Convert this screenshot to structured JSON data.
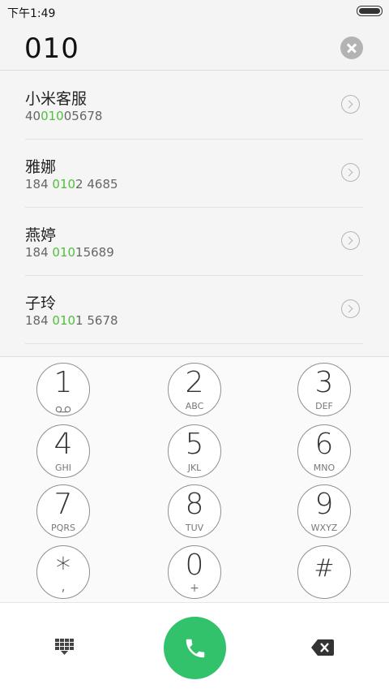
{
  "status": {
    "time": "下午1:49"
  },
  "search": {
    "number": "010"
  },
  "results": [
    {
      "name": "小米客服",
      "pre": "40",
      "match": "010",
      "post": "05678"
    },
    {
      "name": "雅娜",
      "pre": "184 ",
      "match": "010",
      "post": "2 4685"
    },
    {
      "name": "燕婷",
      "pre": "184 ",
      "match": "010",
      "post": "15689"
    },
    {
      "name": "子玲",
      "pre": "184 ",
      "match": "010",
      "post": "1 5678"
    }
  ],
  "keypad": [
    {
      "digit": "1",
      "letters": ""
    },
    {
      "digit": "2",
      "letters": "ABC"
    },
    {
      "digit": "3",
      "letters": "DEF"
    },
    {
      "digit": "4",
      "letters": "GHI"
    },
    {
      "digit": "5",
      "letters": "JKL"
    },
    {
      "digit": "6",
      "letters": "MNO"
    },
    {
      "digit": "7",
      "letters": "PQRS"
    },
    {
      "digit": "8",
      "letters": "TUV"
    },
    {
      "digit": "9",
      "letters": "WXYZ"
    },
    {
      "digit": "*",
      "letters": ","
    },
    {
      "digit": "0",
      "letters": "+"
    },
    {
      "digit": "#",
      "letters": ""
    }
  ],
  "icons": {
    "clear": "clear-icon",
    "voicemail": "voicemail-icon",
    "dialpad": "dialpad-toggle-icon",
    "call": "phone-icon",
    "delete": "backspace-icon",
    "detail": "chevron-right-icon"
  },
  "colors": {
    "highlight": "#4fc03c",
    "call_button": "#33c26c"
  }
}
